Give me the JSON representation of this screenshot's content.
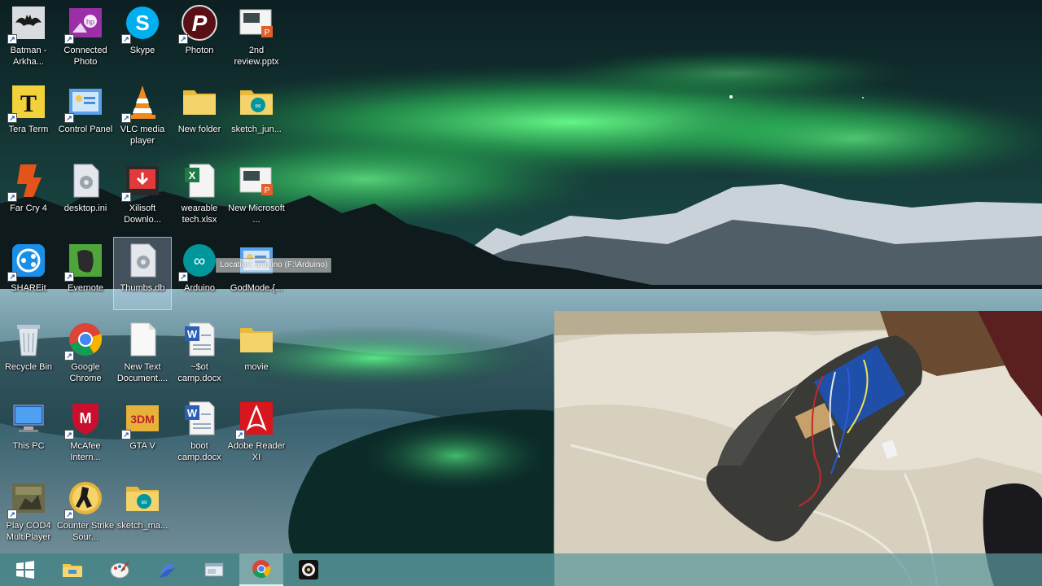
{
  "desktop": {
    "icons": [
      {
        "label": "Batman - Arkha...",
        "icon": "batman-icon",
        "shortcut": true
      },
      {
        "label": "Connected Photo",
        "icon": "hp-photo-icon",
        "shortcut": true
      },
      {
        "label": "Skype",
        "icon": "skype-icon",
        "shortcut": true
      },
      {
        "label": "Photon",
        "icon": "photon-icon",
        "shortcut": true
      },
      {
        "label": "2nd review.pptx",
        "icon": "pptx-file-icon",
        "shortcut": false
      },
      {
        "label": "Tera Term",
        "icon": "tera-term-icon",
        "shortcut": true
      },
      {
        "label": "Control Panel",
        "icon": "control-panel-icon",
        "shortcut": true
      },
      {
        "label": "VLC media player",
        "icon": "vlc-icon",
        "shortcut": true
      },
      {
        "label": "New folder",
        "icon": "folder-icon",
        "shortcut": false
      },
      {
        "label": "sketch_jun...",
        "icon": "arduino-folder-icon",
        "shortcut": false
      },
      {
        "label": "Far Cry 4",
        "icon": "far-cry-icon",
        "shortcut": true
      },
      {
        "label": "desktop.ini",
        "icon": "settings-file-icon",
        "shortcut": false
      },
      {
        "label": "Xilisoft Downlo...",
        "icon": "xilisoft-download-icon",
        "shortcut": true
      },
      {
        "label": "wearable tech.xlsx",
        "icon": "xlsx-file-icon",
        "shortcut": false
      },
      {
        "label": "New Microsoft ...",
        "icon": "pptx-file-icon",
        "shortcut": false
      },
      {
        "label": "SHAREit",
        "icon": "shareit-icon",
        "shortcut": true
      },
      {
        "label": "Evernote",
        "icon": "evernote-icon",
        "shortcut": true
      },
      {
        "label": "Thumbs.db",
        "icon": "settings-file-icon",
        "shortcut": false
      },
      {
        "label": "Arduino",
        "icon": "arduino-icon",
        "shortcut": true
      },
      {
        "label": "GodMode.{...",
        "icon": "control-panel-icon",
        "shortcut": false
      },
      {
        "label": "Recycle Bin",
        "icon": "recycle-bin-icon",
        "shortcut": false
      },
      {
        "label": "Google Chrome",
        "icon": "chrome-icon",
        "shortcut": true
      },
      {
        "label": "New Text Document....",
        "icon": "text-file-icon",
        "shortcut": false
      },
      {
        "label": "~$ot camp.docx",
        "icon": "docx-file-icon",
        "shortcut": false
      },
      {
        "label": "movie",
        "icon": "folder-icon",
        "shortcut": false
      },
      {
        "label": "This PC",
        "icon": "this-pc-icon",
        "shortcut": false
      },
      {
        "label": "McAfee Intern...",
        "icon": "mcafee-icon",
        "shortcut": true
      },
      {
        "label": "GTA V",
        "icon": "3dm-icon",
        "shortcut": true
      },
      {
        "label": "boot camp.docx",
        "icon": "docx-file-icon",
        "shortcut": false
      },
      {
        "label": "Adobe Reader XI",
        "icon": "adobe-reader-icon",
        "shortcut": true
      },
      {
        "label": "Play COD4 MultiPlayer",
        "icon": "cod4-icon",
        "shortcut": true
      },
      {
        "label": "Counter Strike Sour...",
        "icon": "counter-strike-icon",
        "shortcut": true
      },
      {
        "label": "sketch_ma...",
        "icon": "arduino-folder-icon",
        "shortcut": false
      }
    ],
    "selected_index": 17,
    "tooltip": "Location: arduino (F:\\Arduino)"
  },
  "taskbar": {
    "items": [
      {
        "name": "start-button",
        "icon": "windows-logo-icon",
        "active": false
      },
      {
        "name": "file-explorer",
        "icon": "folder-icon",
        "active": false
      },
      {
        "name": "paint",
        "icon": "paint-icon",
        "active": false
      },
      {
        "name": "visual-studio",
        "icon": "visual-studio-icon",
        "active": false
      },
      {
        "name": "app-window",
        "icon": "window-icon",
        "active": false
      },
      {
        "name": "google-chrome",
        "icon": "chrome-icon",
        "active": true
      },
      {
        "name": "media-app",
        "icon": "camera-lens-icon",
        "active": false
      }
    ]
  },
  "colors": {
    "aurora_green": "#3fd86a",
    "sky_dark": "#0d2a2c",
    "taskbar": "#5a969b",
    "label_text": "#ffffff"
  }
}
